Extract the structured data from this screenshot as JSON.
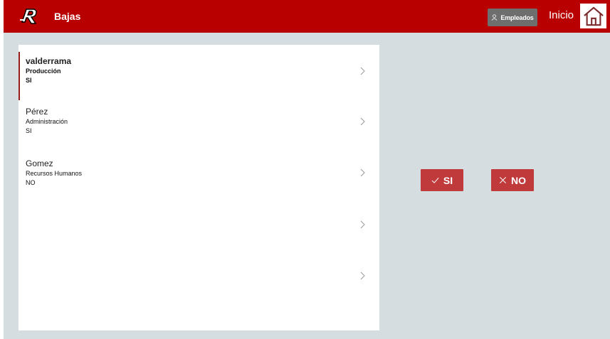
{
  "header": {
    "title": "Bajas",
    "empleados_label": "Empleados",
    "inicio_label": "Inicio"
  },
  "items": [
    {
      "name": "valderrama",
      "department": "Producción",
      "status": "SI"
    },
    {
      "name": "Pérez",
      "department": "Administración",
      "status": "SI"
    },
    {
      "name": "Gomez",
      "department": "Recursos Humanos",
      "status": "NO"
    },
    {
      "name": "",
      "department": "",
      "status": ""
    },
    {
      "name": "",
      "department": "",
      "status": ""
    }
  ],
  "actions": {
    "si_label": "SI",
    "no_label": "NO"
  },
  "colors": {
    "brand": "#b80000",
    "button": "#c0393b",
    "background": "#d6dde1"
  }
}
